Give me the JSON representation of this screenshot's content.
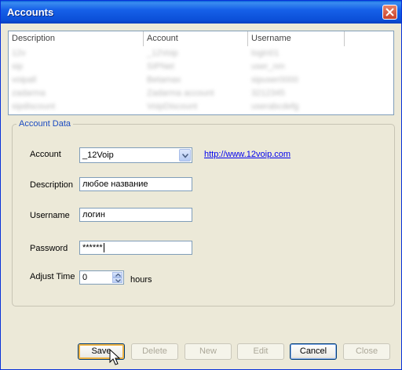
{
  "window": {
    "title": "Accounts"
  },
  "list": {
    "columns": [
      "Description",
      "Account",
      "Username"
    ],
    "rows": [
      [
        "12v",
        "_12Voip",
        "login01"
      ],
      [
        "sip",
        "SIPNet",
        "user_nm"
      ],
      [
        "voipall",
        "Betamax",
        "sipuser0000"
      ],
      [
        "zadarma",
        "Zadarma account",
        "3212345"
      ],
      [
        "sipdiscount",
        "VoipDiscount",
        "userabcdefg"
      ]
    ]
  },
  "account_data": {
    "group_title": "Account Data",
    "account_label": "Account",
    "account_value": "_12Voip",
    "account_link": "http://www.12voip.com",
    "description_label": "Description",
    "description_value": "любое название",
    "username_label": "Username",
    "username_value": "логин",
    "password_label": "Password",
    "password_value": "******",
    "adjust_time_label": "Adjust Time",
    "adjust_time_value": "0",
    "adjust_time_unit": "hours"
  },
  "buttons": {
    "save": "Save",
    "delete": "Delete",
    "new": "New",
    "edit": "Edit",
    "cancel": "Cancel",
    "close": "Close"
  },
  "colors": {
    "title_bar": "#0b4fd8",
    "group_title": "#1c4cc1",
    "link": "#0000ee"
  }
}
